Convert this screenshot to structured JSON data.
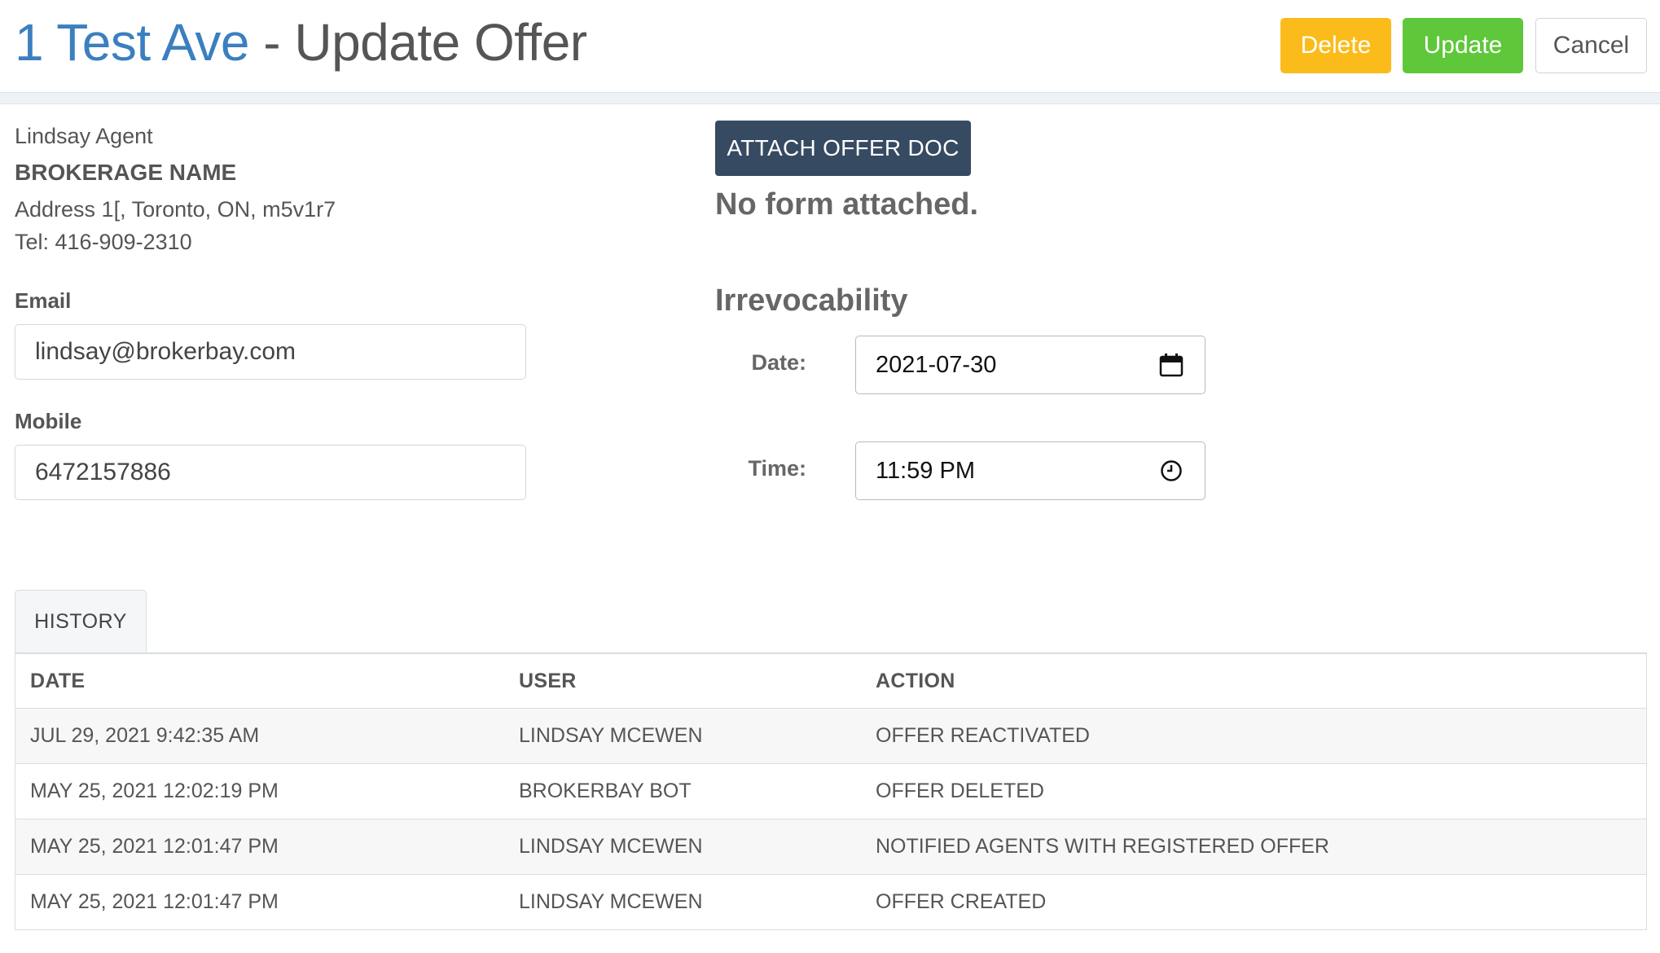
{
  "header": {
    "address": "1 Test Ave",
    "separator": " - ",
    "title": "Update Offer",
    "delete_label": "Delete",
    "update_label": "Update",
    "cancel_label": "Cancel"
  },
  "agent": {
    "name": "Lindsay Agent",
    "brokerage": "BROKERAGE NAME",
    "address": "Address 1[, Toronto, ON, m5v1r7",
    "tel": "Tel: 416-909-2310"
  },
  "email": {
    "label": "Email",
    "value": "lindsay@brokerbay.com"
  },
  "mobile": {
    "label": "Mobile",
    "value": "6472157886"
  },
  "offer_doc": {
    "attach_label": "ATTACH OFFER DOC",
    "status": "No form attached."
  },
  "irrevocability": {
    "title": "Irrevocability",
    "date_label": "Date:",
    "date_value": "2021-07-30",
    "time_label": "Time:",
    "time_value": "11:59 PM",
    "date_icon": "calendar-icon",
    "time_icon": "clock-icon"
  },
  "history": {
    "tab_label": "HISTORY",
    "columns": [
      "DATE",
      "USER",
      "ACTION"
    ],
    "rows": [
      [
        "JUL 29, 2021 9:42:35 AM",
        "LINDSAY MCEWEN",
        "OFFER REACTIVATED"
      ],
      [
        "MAY 25, 2021 12:02:19 PM",
        "BROKERBAY BOT",
        "OFFER DELETED"
      ],
      [
        "MAY 25, 2021 12:01:47 PM",
        "LINDSAY MCEWEN",
        "NOTIFIED AGENTS WITH REGISTERED OFFER"
      ],
      [
        "MAY 25, 2021 12:01:47 PM",
        "LINDSAY MCEWEN",
        "OFFER CREATED"
      ]
    ]
  },
  "colors": {
    "address_blue": "#3b7fbf",
    "delete_yellow": "#fbbb1a",
    "update_green": "#5ec73a",
    "attach_navy": "#364a62"
  }
}
